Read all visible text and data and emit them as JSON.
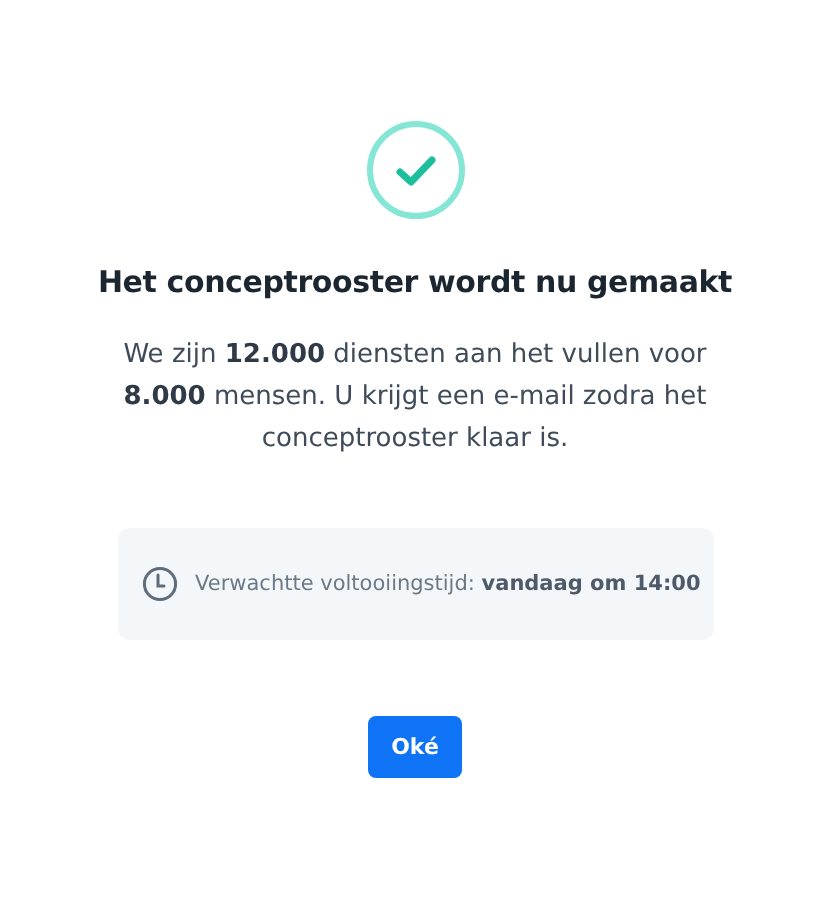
{
  "dialog": {
    "title": "Het conceptrooster wordt nu gemaakt",
    "message": "We zijn **12.000** diensten aan het vullen voor **8.000** mensen. U krijgt een e-mail zodra het conceptrooster klaar is.",
    "info": "Verwachtte voltooiingstijd: **vandaag om 14:00**",
    "buttons": [
      "Oké"
    ]
  }
}
